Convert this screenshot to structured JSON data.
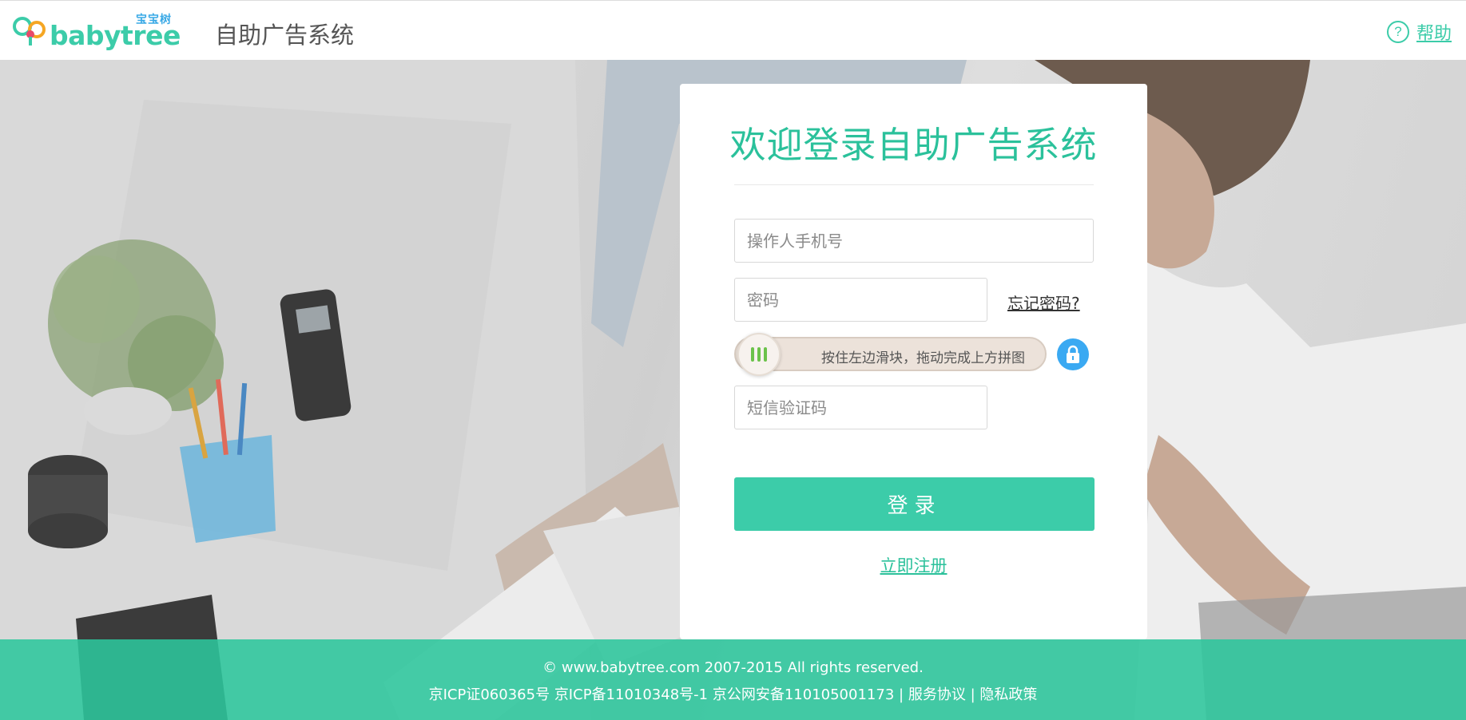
{
  "header": {
    "logo_cn": "宝宝树",
    "logo_en": "babytree",
    "title": "自助广告系统",
    "help_label": "帮助",
    "help_icon": "question-circle-icon"
  },
  "login": {
    "title": "欢迎登录自助广告系统",
    "phone_placeholder": "操作人手机号",
    "password_placeholder": "密码",
    "forgot_label": "忘记密码?",
    "slider_text": "按住左边滑块，拖动完成上方拼图",
    "lock_icon": "lock-icon",
    "sms_placeholder": "短信验证码",
    "submit_label": "登录",
    "register_label": "立即注册"
  },
  "footer": {
    "copyright": "© www.babytree.com 2007-2015 All rights reserved.",
    "icp1": "京ICP证060365号",
    "icp2": "京ICP备11010348号-1",
    "police": "京公网安备110105001173",
    "sep": "|",
    "terms": "服务协议",
    "privacy": "隐私政策"
  },
  "colors": {
    "accent": "#3ccca9",
    "title_green": "#2bc19b",
    "lock_blue": "#3aa9f2",
    "footer_bg": "#2cc69c"
  }
}
